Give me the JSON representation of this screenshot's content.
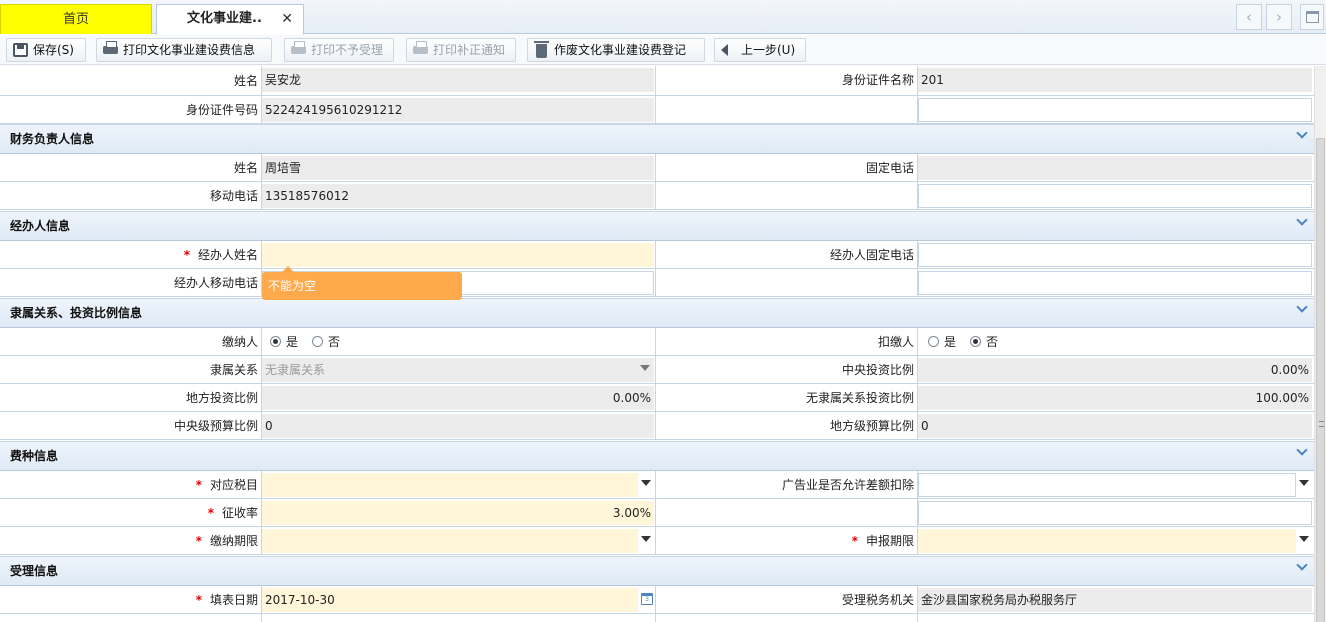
{
  "tabs": {
    "home": "首页",
    "doc": "文化事业建..",
    "close_glyph": "✕",
    "prev_glyph": "‹",
    "next_glyph": "›"
  },
  "toolbar": {
    "save": "保存(S)",
    "print_info": "打印文化事业建设费信息",
    "print_reject": "打印不予受理",
    "print_correction": "打印补正通知",
    "void": "作废文化事业建设费登记",
    "back": "上一步(U)"
  },
  "legal": {
    "name_label": "姓名",
    "name_value": "吴安龙",
    "id_type_label": "身份证件名称",
    "id_type_value": "201",
    "id_no_label": "身份证件号码",
    "id_no_value": "522424195610291212"
  },
  "finance": {
    "title": "财务负责人信息",
    "name_label": "姓名",
    "name_value": "周培雪",
    "phone_label": "固定电话",
    "phone_value": "",
    "mobile_label": "移动电话",
    "mobile_value": "13518576012"
  },
  "agent": {
    "title": "经办人信息",
    "name_label": "经办人姓名",
    "name_value": "",
    "phone_label": "经办人固定电话",
    "phone_value": "",
    "mobile_label": "经办人移动电话",
    "mobile_value": "",
    "error_tooltip": "不能为空"
  },
  "affiliation": {
    "title": "隶属关系、投资比例信息",
    "taxpayer_label": "缴纳人",
    "withholder_label": "扣缴人",
    "yes": "是",
    "no": "否",
    "taxpayer_selected": "是",
    "withholder_selected": "否",
    "relation_label": "隶属关系",
    "relation_value": "无隶属关系",
    "central_ratio_label": "中央投资比例",
    "central_ratio_value": "0.00%",
    "local_ratio_label": "地方投资比例",
    "local_ratio_value": "0.00%",
    "none_ratio_label": "无隶属关系投资比例",
    "none_ratio_value": "100.00%",
    "central_budget_label": "中央级预算比例",
    "central_budget_value": "0",
    "local_budget_label": "地方级预算比例",
    "local_budget_value": "0"
  },
  "fee": {
    "title": "费种信息",
    "tax_item_label": "对应税目",
    "tax_item_value": "",
    "ad_deduct_label": "广告业是否允许差额扣除",
    "ad_deduct_value": "",
    "rate_label": "征收率",
    "rate_value": "3.00%",
    "pay_period_label": "缴纳期限",
    "pay_period_value": "",
    "report_period_label": "申报期限",
    "report_period_value": ""
  },
  "accept": {
    "title": "受理信息",
    "date_label": "填表日期",
    "date_value": "2017-10-30",
    "office_label": "受理税务机关",
    "office_value": "金沙县国家税务局办税服务厅"
  },
  "colors": {
    "home_tab": "#ffff00",
    "required_field": "#fff6d9",
    "readonly_field": "#ececec",
    "section_header": "#dfeaf6",
    "error_tooltip": "#ffa94d",
    "required_mark": "#e00000"
  },
  "icons": [
    "save-icon",
    "print-icon",
    "trash-icon",
    "back-arrow-icon",
    "calendar-icon",
    "chevron-down-icon",
    "chevron-left-icon",
    "chevron-right-icon",
    "maximize-icon",
    "close-icon",
    "dropdown-arrow-icon"
  ]
}
